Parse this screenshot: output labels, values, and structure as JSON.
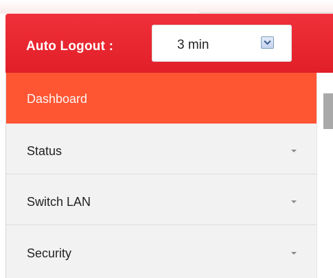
{
  "header": {
    "auto_logout_label": "Auto Logout :",
    "auto_logout_value": "3 min",
    "brand_color": "#e8262f"
  },
  "menu": {
    "active_color": "#fe5533",
    "items": [
      {
        "label": "Dashboard",
        "active": true,
        "has_dropdown": false
      },
      {
        "label": "Status",
        "active": false,
        "has_dropdown": true
      },
      {
        "label": "Switch LAN",
        "active": false,
        "has_dropdown": true
      },
      {
        "label": "Security",
        "active": false,
        "has_dropdown": true
      }
    ]
  },
  "icons": {
    "select_arrow": "chevron-down-icon",
    "menu_caret": "caret-down-icon"
  }
}
